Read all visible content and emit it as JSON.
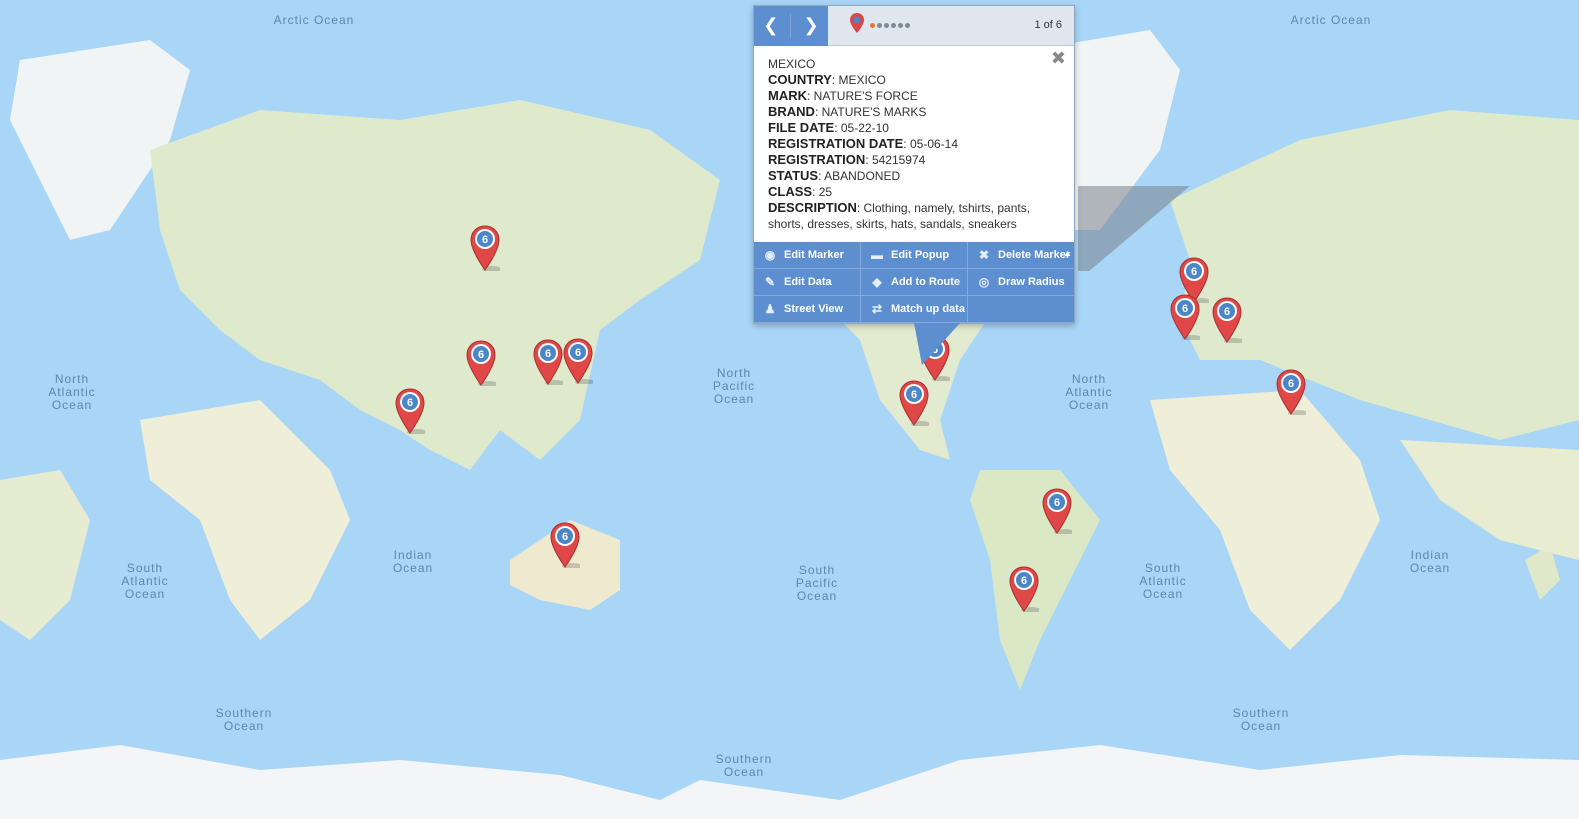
{
  "map": {
    "ocean_labels": [
      {
        "id": "arctic-ocean-left",
        "text": "Arctic Ocean"
      },
      {
        "id": "arctic-ocean-right",
        "text": "Arctic Ocean"
      },
      {
        "id": "north-atlantic-left",
        "text": "North\nAtlantic\nOcean"
      },
      {
        "id": "north-pacific",
        "text": "North\nPacific\nOcean"
      },
      {
        "id": "north-atlantic-right",
        "text": "North\nAtlantic\nOcean"
      },
      {
        "id": "south-atlantic-left",
        "text": "South\nAtlantic\nOcean"
      },
      {
        "id": "indian-ocean-left",
        "text": "Indian\nOcean"
      },
      {
        "id": "south-pacific",
        "text": "South\nPacific\nOcean"
      },
      {
        "id": "south-atlantic-right",
        "text": "South\nAtlantic\nOcean"
      },
      {
        "id": "indian-ocean-right",
        "text": "Indian\nOcean"
      },
      {
        "id": "southern-ocean-left",
        "text": "Southern\nOcean"
      },
      {
        "id": "southern-ocean-mid",
        "text": "Southern\nOcean"
      },
      {
        "id": "southern-ocean-right",
        "text": "Southern\nOcean"
      }
    ],
    "marker_label": "6",
    "marker_color": "#e04848",
    "marker_inner_color": "#4a86c8",
    "ocean_color": "#a9d6f7",
    "land_color": "#e8f0d8"
  },
  "popup": {
    "counter": "1 of 6",
    "dots_total": 6,
    "dots_active": 1,
    "title": "MEXICO",
    "fields": [
      {
        "label": "COUNTRY",
        "value": "MEXICO"
      },
      {
        "label": "MARK",
        "value": "NATURE'S FORCE"
      },
      {
        "label": "BRAND",
        "value": "NATURE'S MARKS"
      },
      {
        "label": "FILE DATE",
        "value": "05-22-10"
      },
      {
        "label": "REGISTRATION DATE",
        "value": "05-06-14"
      },
      {
        "label": "REGISTRATION",
        "value": "54215974"
      },
      {
        "label": "STATUS",
        "value": "ABANDONED"
      },
      {
        "label": "CLASS",
        "value": "25"
      },
      {
        "label": "DESCRIPTION",
        "value": "Clothing, namely, tshirts, pants, shorts, dresses, skirts, hats, sandals, sneakers"
      }
    ],
    "actions": [
      {
        "label": "Edit Marker",
        "icon": "map-pin-icon"
      },
      {
        "label": "Edit Popup",
        "icon": "speech-bubble-icon"
      },
      {
        "label": "Delete Marker",
        "icon": "delete-circle-icon"
      },
      {
        "label": "Edit Data",
        "icon": "pencil-icon"
      },
      {
        "label": "Add to Route",
        "icon": "route-diamond-icon"
      },
      {
        "label": "Draw Radius",
        "icon": "radius-circle-icon"
      },
      {
        "label": "Street View",
        "icon": "pegman-icon"
      },
      {
        "label": "Match up data",
        "icon": "link-icon"
      },
      {
        "label": "",
        "icon": ""
      }
    ],
    "accent_color": "#5d8fd0"
  }
}
